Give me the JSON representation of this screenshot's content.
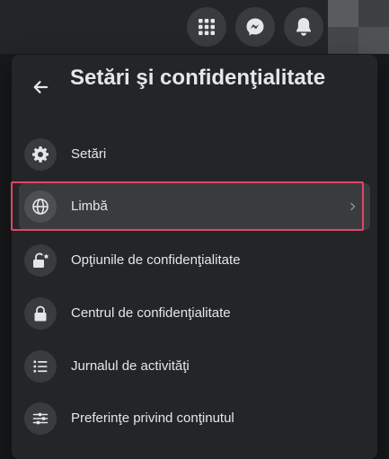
{
  "topbar": {
    "buttons": [
      {
        "name": "menu",
        "icon": "grid-icon"
      },
      {
        "name": "messenger",
        "icon": "messenger-icon"
      },
      {
        "name": "notifications",
        "icon": "bell-icon"
      }
    ],
    "avatar_colors": [
      "#5a5b5c",
      "#3f4041",
      "#454647",
      "#505152"
    ]
  },
  "panel": {
    "title": "Setări şi confidenţialitate",
    "back_icon": "arrow-left-icon",
    "items": [
      {
        "label": "Setări",
        "icon": "gear-icon"
      },
      {
        "label": "Limbă",
        "icon": "globe-icon",
        "selected": true,
        "has_chevron": true
      },
      {
        "label": "Opţiunile de confidenţialitate",
        "icon": "lock-star-icon"
      },
      {
        "label": "Centrul de confidenţialitate",
        "icon": "lock-icon"
      },
      {
        "label": "Jurnalul de activităţi",
        "icon": "list-icon"
      },
      {
        "label": "Preferinţe privind conţinutul",
        "icon": "sliders-icon"
      }
    ]
  },
  "colors": {
    "highlight": "#e0456b",
    "text": "#e4e6eb",
    "panel_bg": "#242526"
  }
}
